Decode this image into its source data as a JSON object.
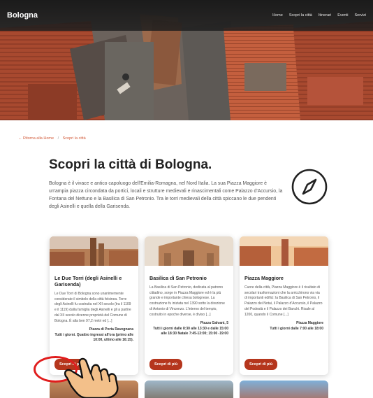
{
  "header": {
    "brand": "Bologna",
    "nav": [
      "Home",
      "Scopri la città",
      "Itinerari",
      "Eventi",
      "Servizi"
    ]
  },
  "breadcrumb": {
    "home": "← Ritorna alla Home",
    "separator": "/",
    "current": "Scopri la città"
  },
  "main": {
    "title": "Scopri la città di Bologna.",
    "intro": "Bologna è il vivace e antico capoluogo dell'Emilia-Romagna, nel Nord Italia. La sua Piazza Maggiore è un'ampia piazza circondata da portici, locali e strutture medievali e rinascimentali come Palazzo d'Accursio, la Fontana del Nettuno e la Basilica di San Petronio. Tra le torri medievali della città spiccano le due pendenti degli Asinelli e quella della Garisenda.",
    "compass_icon": "compass-icon"
  },
  "cards": [
    {
      "title": "Le Due Torri (degli Asinelli e Garisenda)",
      "text": "Le Due Torri di Bologna sono unanimemente considerate il simbolo della città felsinea. Torre degli Asinelli fu costruita nel XII secolo (tra il 1109 e il 1119) dalla famiglia degli Asinelli e gli a partire dal XII secolo divenne proprietà del Comune di Bologna. È alta ben 97,2 metri ed [...]",
      "address": "Piazza di Porta Ravegnana",
      "hours": "Tutti i giorni. Quattro ingressi all'ora (primo alle 10:00, ultimo alle 16:15).",
      "button": "Scopri di più"
    },
    {
      "title": "Basilica di San Petronio",
      "text": "La Basilica di San Petronio, dedicata al patrono cittadino, sorge in Piazza Maggiore ed è la più grande e importante chiesa bolognese. La costruzione fu iniziata nel 1390 sotto la direzione di Antonio di Vincenzo. L'interno del tempio, costruito in epoche diverse, è diviso [...]",
      "address": "Piazza Galvani, 5",
      "hours": "Tutti i giorni dalle 8:30 alle 13:30 e dalle 15:00 alle 18:30 Natale 7:45-13:00; 15:00 -19:00",
      "button": "Scopri di più"
    },
    {
      "title": "Piazza Maggiore",
      "text": "Cuore della città, Piazza Maggiore è il risultato di secolari trasformazioni che la arricchirono via via di importanti edifici: la Basilica di San Petronio, il Palazzo dei Notai, il Palazzo d'Accursio, il Palazzo del Podestà e il Palazzo dei Banchi. Risale al 1200, quando il Comune [...]",
      "address": "Piazza Maggiore",
      "hours": "Tutti i giorni dalle 7:00 alle 18:00",
      "button": "Scopri di più"
    }
  ],
  "colors": {
    "accent": "#b5361d",
    "link": "#d25b3a",
    "highlight": "#e01d1d"
  }
}
